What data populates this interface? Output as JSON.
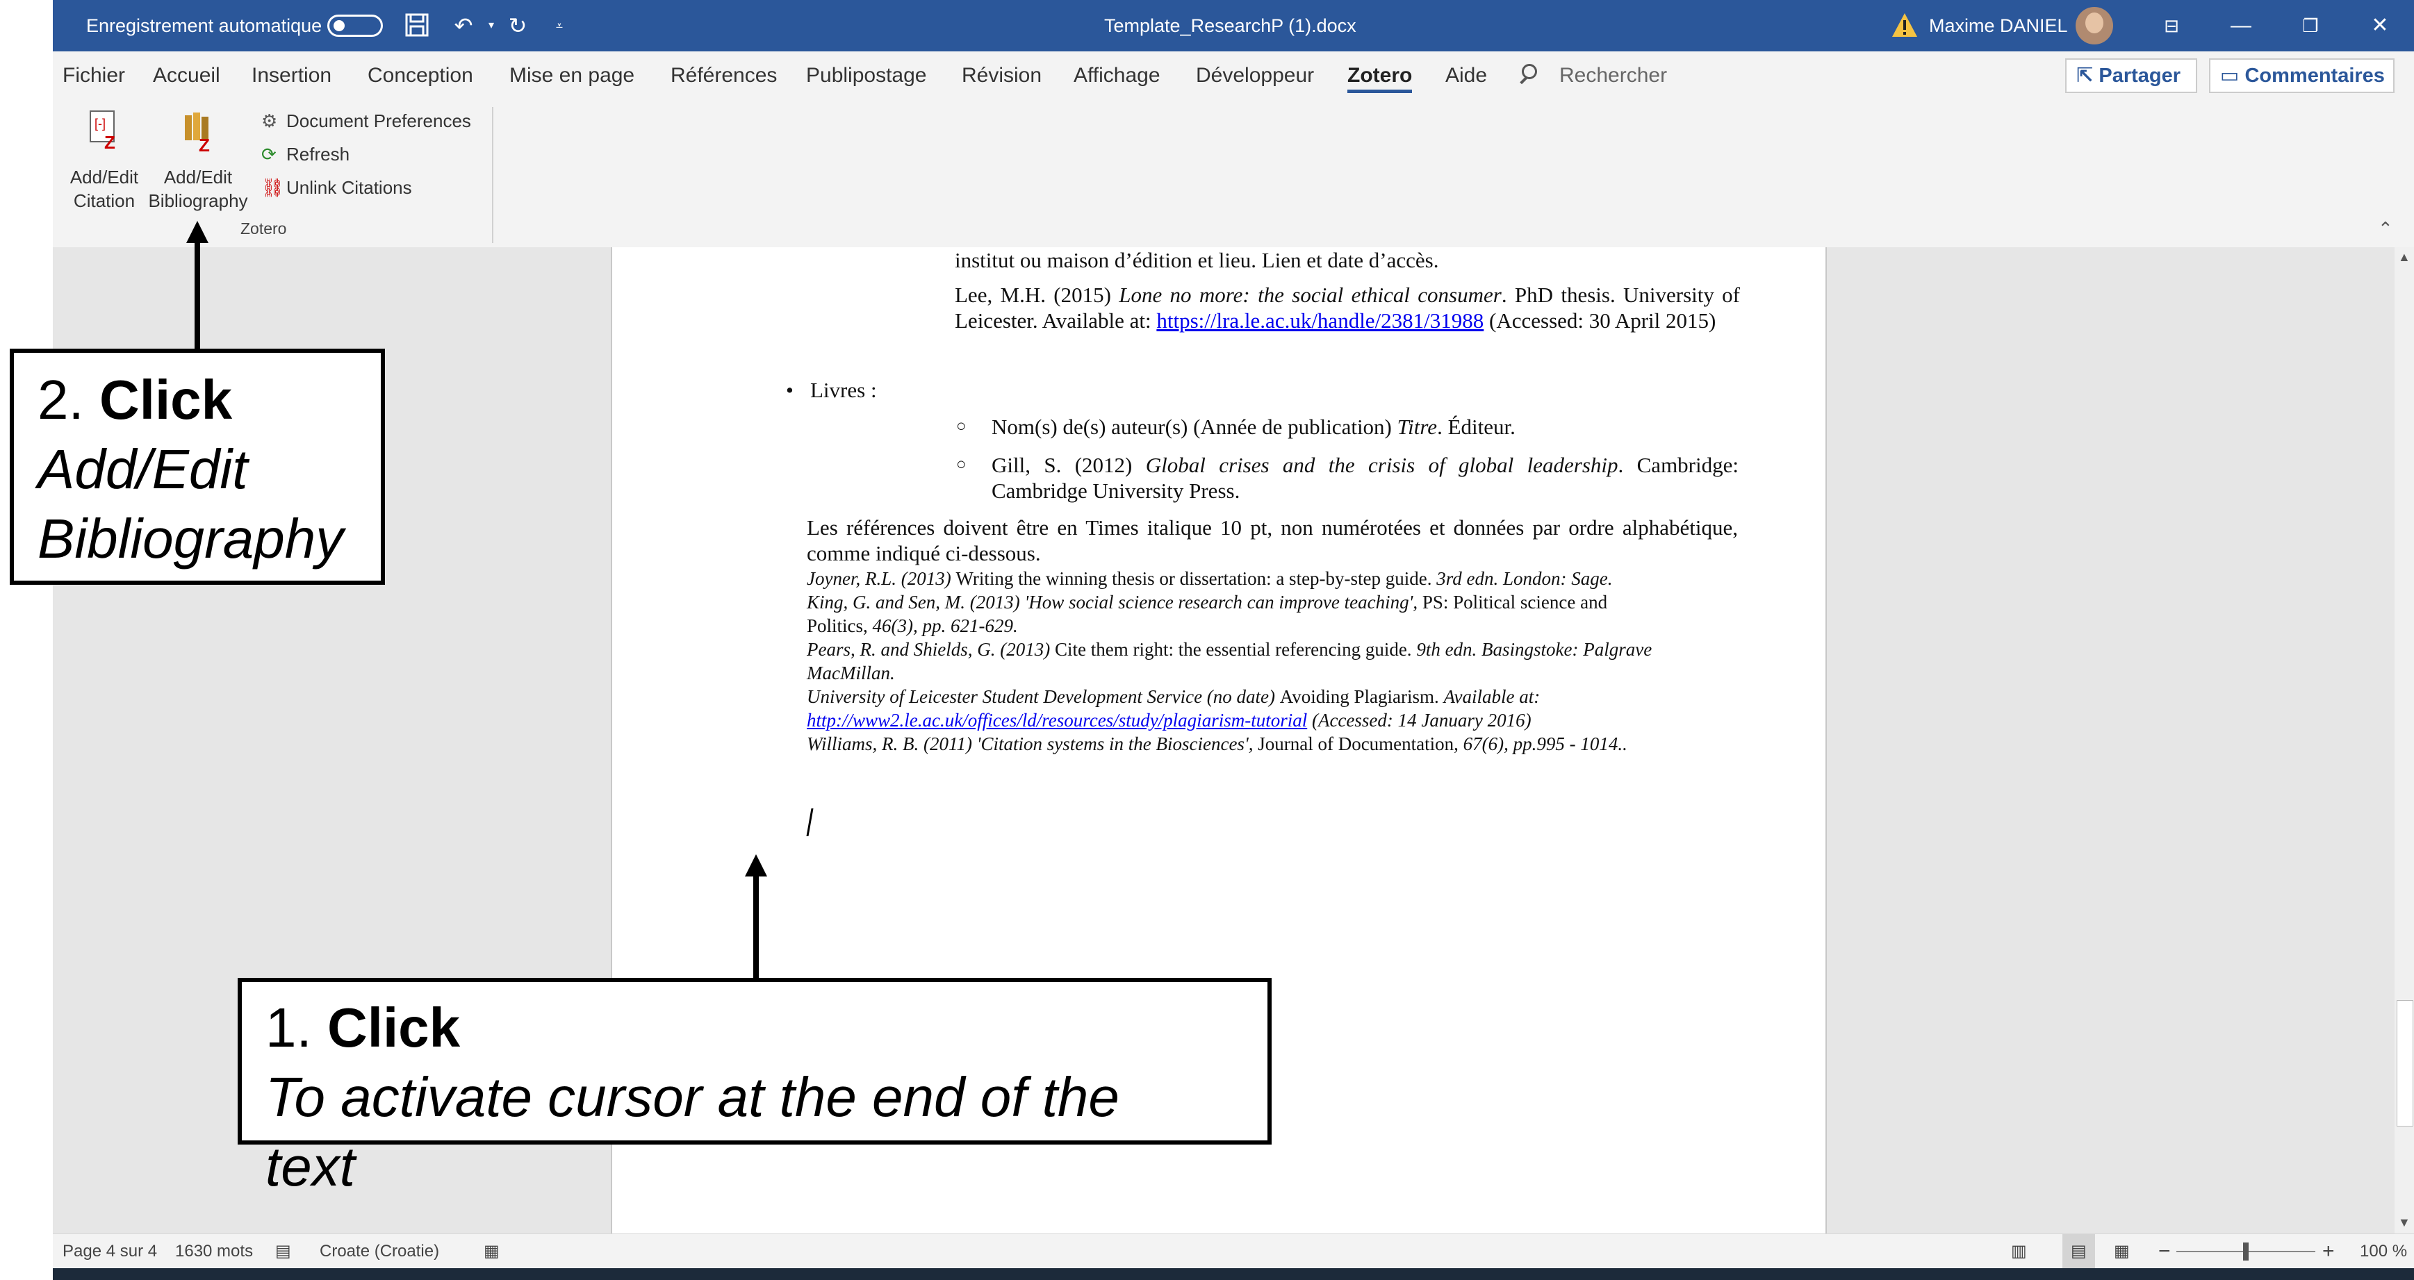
{
  "titlebar": {
    "autosave_label": "Enregistrement automatique",
    "doc_title": "Template_ResearchP (1).docx",
    "user_name": "Maxime DANIEL"
  },
  "menu": {
    "items": [
      "Fichier",
      "Accueil",
      "Insertion",
      "Conception",
      "Mise en page",
      "Références",
      "Publipostage",
      "Révision",
      "Affichage",
      "Développeur",
      "Zotero",
      "Aide"
    ],
    "search_placeholder": "Rechercher",
    "share_label": "Partager",
    "comments_label": "Commentaires",
    "active": "Zotero"
  },
  "ribbon": {
    "citation_line1": "Add/Edit",
    "citation_line2": "Citation",
    "bibliography_line1": "Add/Edit",
    "bibliography_line2": "Bibliography",
    "doc_prefs": "Document Preferences",
    "refresh": "Refresh",
    "unlink": "Unlink Citations",
    "group_name": "Zotero"
  },
  "document": {
    "line_top": "institut ou maison d’édition et lieu. Lien et date d’accès.",
    "lee_a": "Lee, M.H. (2015) ",
    "lee_title": "Lone no more: the social ethical consumer",
    "lee_b": ". PhD thesis. University of Leicester. Available at: ",
    "lee_link": "https://lra.le.ac.uk/handle/2381/31988",
    "lee_c": " (Accessed: 30 April 2015)",
    "livres": "Livres :",
    "nom_a": "Nom(s) de(s) auteur(s) (Année de publication) ",
    "nom_title": "Titre",
    "nom_b": ".  Éditeur.",
    "gill_a": "Gill, S. (2012) ",
    "gill_title": "Global crises and the crisis of global leadership",
    "gill_b": ". Cambridge: Cambridge University Press.",
    "refs_intro": "Les références doivent être en Times italique 10 pt, non numérotées et données par ordre alphabétique, comme indiqué ci-dessous.",
    "ref1_a": "Joyner, R.L. (2013) ",
    "ref1_b": "Writing the winning thesis or dissertation: a step-by-step guide. ",
    "ref1_c": "3rd edn. London: Sage.",
    "ref2_a": "King, G. and Sen, M. (2013) 'How social science research can improve teaching', ",
    "ref2_b": "PS: Political science and",
    "ref2_c": "Politics, ",
    "ref2_d": "46(3), pp. 621-629.",
    "ref3_a": "Pears, R. and Shields, G. (2013) ",
    "ref3_b": "Cite them right: the essential referencing guide. ",
    "ref3_c": "9th edn. Basingstoke: Palgrave",
    "ref3_d": "MacMillan.",
    "ref4_a": "University of Leicester Student Development Service (no date) ",
    "ref4_b": "Avoiding Plagiarism. ",
    "ref4_c": "Available at:",
    "ref4_link": "http://www2.le.ac.uk/offices/ld/resources/study/plagiarism-tutorial",
    "ref4_d": " (Accessed: 14 January 2016)",
    "ref5_a": "Williams, R. B. (2011) 'Citation systems in the Biosciences', ",
    "ref5_b": "Journal of Documentation, ",
    "ref5_c": "67(6), pp.995 - 1014.."
  },
  "statusbar": {
    "page": "Page 4 sur 4",
    "words": "1630 mots",
    "language": "Croate (Croatie)",
    "zoom": "100 %"
  },
  "annotations": {
    "step2_num": "2. ",
    "step2_action": "Click",
    "step2_line1": "Add/Edit",
    "step2_line2": "Bibliography",
    "step1_num": "1. ",
    "step1_action": "Click",
    "step1_line1": "To activate cursor at the end of the",
    "step1_line2": "text"
  },
  "colors": {
    "titlebar": "#2b579a",
    "ribbon": "#f3f3f3",
    "doc_background": "#e6e6e6"
  }
}
